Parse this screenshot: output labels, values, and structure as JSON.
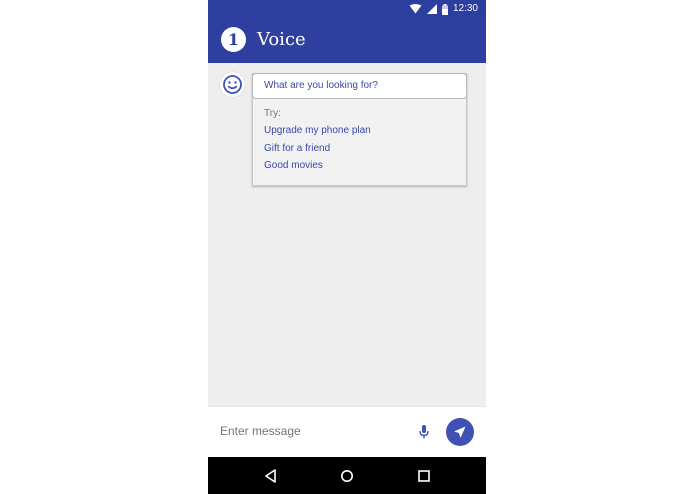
{
  "status_bar": {
    "time": "12:30",
    "icons": [
      "wifi-icon",
      "signal-icon",
      "battery-icon"
    ]
  },
  "app_bar": {
    "badge": "1",
    "title": "Voice"
  },
  "chat": {
    "avatar_icon": "smiley-icon",
    "prompt": "What are you looking for?",
    "try_label": "Try:",
    "suggestions": [
      "Upgrade my phone plan",
      "Gift for a friend",
      "Good movies"
    ]
  },
  "composer": {
    "placeholder": "Enter message",
    "mic_icon": "microphone-icon",
    "send_icon": "send-icon"
  },
  "nav_bar": {
    "icons": [
      "back-icon",
      "home-icon",
      "recents-icon"
    ]
  },
  "colors": {
    "primary": "#2f3fa0",
    "accent": "#3f51b5",
    "link": "#3949ab",
    "background": "#eeeeee"
  }
}
